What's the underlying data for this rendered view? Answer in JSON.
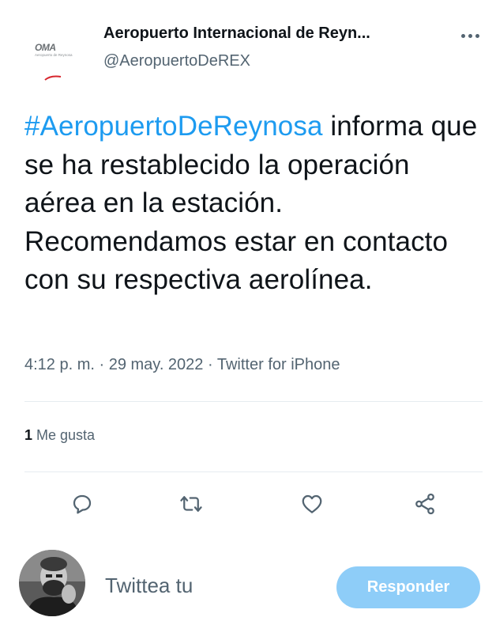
{
  "author": {
    "display_name": "Aeropuerto Internacional de Reyn...",
    "handle": "@AeropuertoDeREX",
    "logo_text": "OMA",
    "logo_subtext": "Aeropuerto de Reynosa"
  },
  "tweet": {
    "hashtag": "#AeropuertoDeReynosa",
    "body": " informa que se ha restablecido la operación aérea en la estación. Recomendamos estar en contacto con su respectiva aerolínea."
  },
  "meta": {
    "time": "4:12 p. m.",
    "separator": " · ",
    "date": "29 may. 2022",
    "source": "Twitter for iPhone"
  },
  "stats": {
    "likes_count": "1",
    "likes_label": " Me gusta"
  },
  "actions": {
    "icons": [
      "reply-icon",
      "retweet-icon",
      "like-icon",
      "share-icon"
    ]
  },
  "reply_bar": {
    "placeholder": "Twittea tu",
    "button_label": "Responder"
  },
  "colors": {
    "accent": "#1d9bf0",
    "button_disabled": "#8ecdf8",
    "secondary_text": "#536471",
    "divider": "#e6ecf0"
  }
}
